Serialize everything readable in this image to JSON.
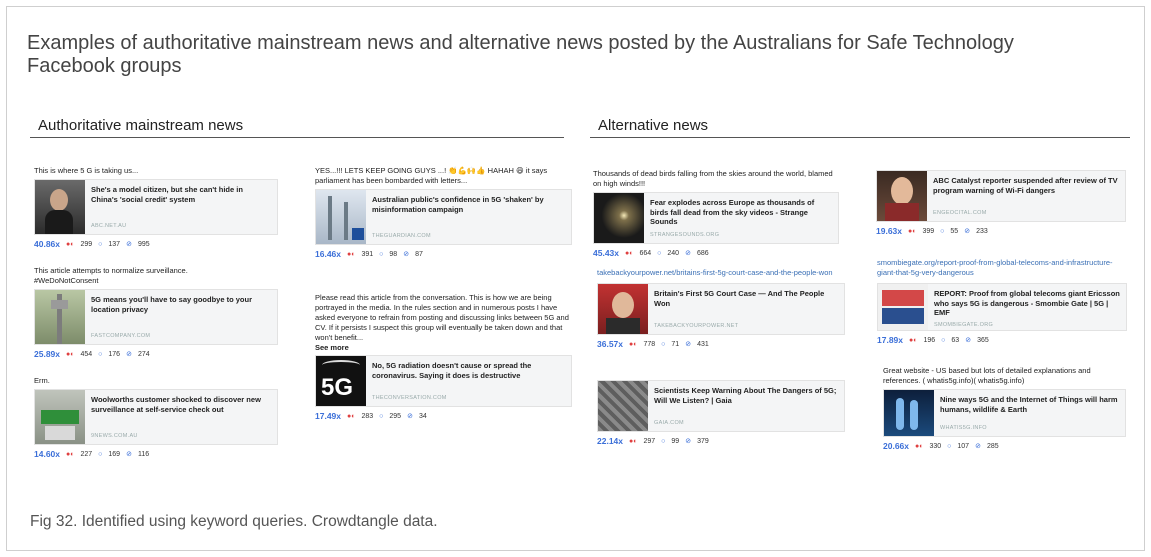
{
  "title": "Examples of authoritative mainstream news and alternative news posted by the Australians for Safe Technology Facebook groups",
  "caption": "Fig 32.  Identified using keyword queries. Crowdtangle data.",
  "sections": {
    "mainstream": {
      "heading": "Authoritative mainstream news"
    },
    "alternative": {
      "heading": "Alternative news"
    }
  },
  "posts": [
    {
      "text": "This is where 5 G is taking us...",
      "card_title": "She's a model citizen, but she can't hide in China's 'social credit' system",
      "domain": "ABC.NET.AU",
      "ratio": "40.86x",
      "reactions": "299",
      "comments": "137",
      "shares": "995"
    },
    {
      "text": "This article attempts to normalize surveillance. #WeDoNotConsent",
      "card_title": "5G means you'll have to say goodbye to your location privacy",
      "domain": "FASTCOMPANY.COM",
      "ratio": "25.89x",
      "reactions": "454",
      "comments": "176",
      "shares": "274"
    },
    {
      "text": "Erm.",
      "card_title": "Woolworths customer shocked to discover new surveillance at self-service check out",
      "domain": "9NEWS.COM.AU",
      "ratio": "14.60x",
      "reactions": "227",
      "comments": "169",
      "shares": "116"
    },
    {
      "text": "YES...!!! LETS KEEP GOING GUYS ...! 👏💪🙌👍 HAHAH 😄 it says parliament has been bombarded with letters...",
      "card_title": "Australian public's confidence in 5G 'shaken' by misinformation campaign",
      "domain": "THEGUARDIAN.COM",
      "ratio": "16.46x",
      "reactions": "391",
      "comments": "98",
      "shares": "87"
    },
    {
      "text": "Please read this article from the conversation. This is how we are being portrayed in the media. In the rules section and in numerous posts I have asked everyone to refrain from posting and discussing links between 5G and CV. If it persists I suspect this group will eventually be taken down and that won't benefit...",
      "see_more": "See more",
      "card_title": "No, 5G radiation doesn't cause or spread the coronavirus. Saying it does is destructive",
      "domain": "THECONVERSATION.COM",
      "thumb_label": "5G",
      "ratio": "17.49x",
      "reactions": "283",
      "comments": "295",
      "shares": "34"
    },
    {
      "text": "Thousands of dead birds falling from the skies around the world, blamed on high winds!!!",
      "card_title": "Fear explodes across Europe as thousands of birds fall dead from the sky videos - Strange Sounds",
      "domain": "STRANGESOUNDS.ORG",
      "ratio": "45.43x",
      "reactions": "664",
      "comments": "240",
      "shares": "686"
    },
    {
      "text": "takebackyourpower.net/britains-first-5g-court-case-and-the-people-won",
      "card_title": "Britain's First 5G Court Case — And The People Won",
      "domain": "TAKEBACKYOURPOWER.NET",
      "ratio": "36.57x",
      "reactions": "778",
      "comments": "71",
      "shares": "431"
    },
    {
      "text": "",
      "card_title": "Scientists Keep Warning About The Dangers of 5G; Will We Listen? | Gaia",
      "domain": "GAIA.COM",
      "ratio": "22.14x",
      "reactions": "297",
      "comments": "99",
      "shares": "379"
    },
    {
      "text": "",
      "card_title": "ABC Catalyst reporter suspended after review of TV program warning of Wi-Fi dangers",
      "domain": "ENGEOCITAL.COM",
      "ratio": "19.63x",
      "reactions": "399",
      "comments": "55",
      "shares": "233"
    },
    {
      "text": "smombiegate.org/report-proof-from-global-telecoms-and-infrastructure-giant-that-5g-very-dangerous",
      "card_title": "REPORT: Proof from global telecoms giant Ericsson who says 5G is dangerous - Smombie Gate | 5G | EMF",
      "domain": "SMOMBIEGATE.ORG",
      "ratio": "17.89x",
      "reactions": "196",
      "comments": "63",
      "shares": "365"
    },
    {
      "text": "Great website - US based but lots of detailed explanations and references. ( whatis5g.info)( whatis5g.info)",
      "card_title": "Nine ways 5G and the Internet of Things will harm humans, wildlife & Earth",
      "domain": "WHATIS5G.INFO",
      "ratio": "20.66x",
      "reactions": "330",
      "comments": "107",
      "shares": "285"
    }
  ],
  "colors": {
    "link_blue": "#3a6fb5",
    "ratio_blue": "#3b6fd8",
    "card_bg": "#f4f5f6"
  },
  "icons": {
    "reactions": "reaction-icon",
    "comments": "comment-icon",
    "shares": "share-icon"
  }
}
